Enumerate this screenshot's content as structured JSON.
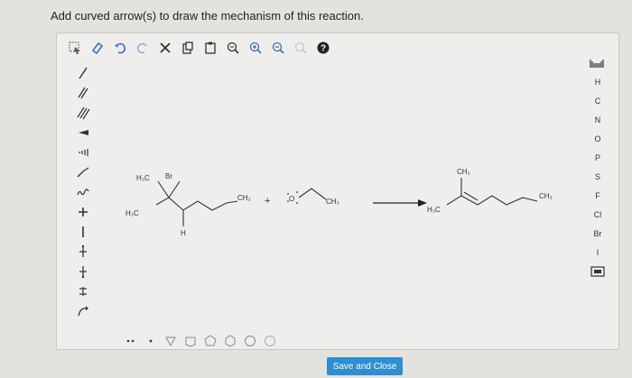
{
  "prompt": "Add curved arrow(s) to draw the mechanism of this reaction.",
  "toolbar": [
    {
      "name": "select-arrow-icon"
    },
    {
      "name": "eraser-icon"
    },
    {
      "name": "undo-icon"
    },
    {
      "name": "redo-icon"
    },
    {
      "name": "delete-icon"
    },
    {
      "name": "copy-icon"
    },
    {
      "name": "paste-icon"
    },
    {
      "name": "zoom-reset-icon"
    },
    {
      "name": "zoom-in-icon"
    },
    {
      "name": "zoom-out-icon"
    },
    {
      "name": "zoom-fit-icon"
    },
    {
      "name": "help-icon"
    }
  ],
  "left_tools": {
    "single_bond": "single-bond-icon",
    "double_bond": "double-bond-icon",
    "triple_bond": "triple-bond-icon"
  },
  "right_tools": {
    "elements": [
      "H",
      "C",
      "N",
      "O",
      "P",
      "S",
      "F",
      "Cl",
      "Br",
      "I"
    ]
  },
  "reaction": {
    "reactant_atoms": {
      "h3c_top": "H₃C",
      "br": "Br",
      "h3c_left": "H₃C",
      "h": "H",
      "ch3_right": "CH₃"
    },
    "plus": "+",
    "base_o": "O",
    "base_ch3": "CH₃",
    "product_atoms": {
      "ch3_top": "CH₃",
      "h3c_left": "H₃C",
      "ch3_right": "CH₃"
    }
  },
  "save_button": "Save and Close",
  "colors": {
    "accent": "#2d8fd1",
    "page_bg": "#e4e2df",
    "editor_bg": "#efeeec"
  }
}
